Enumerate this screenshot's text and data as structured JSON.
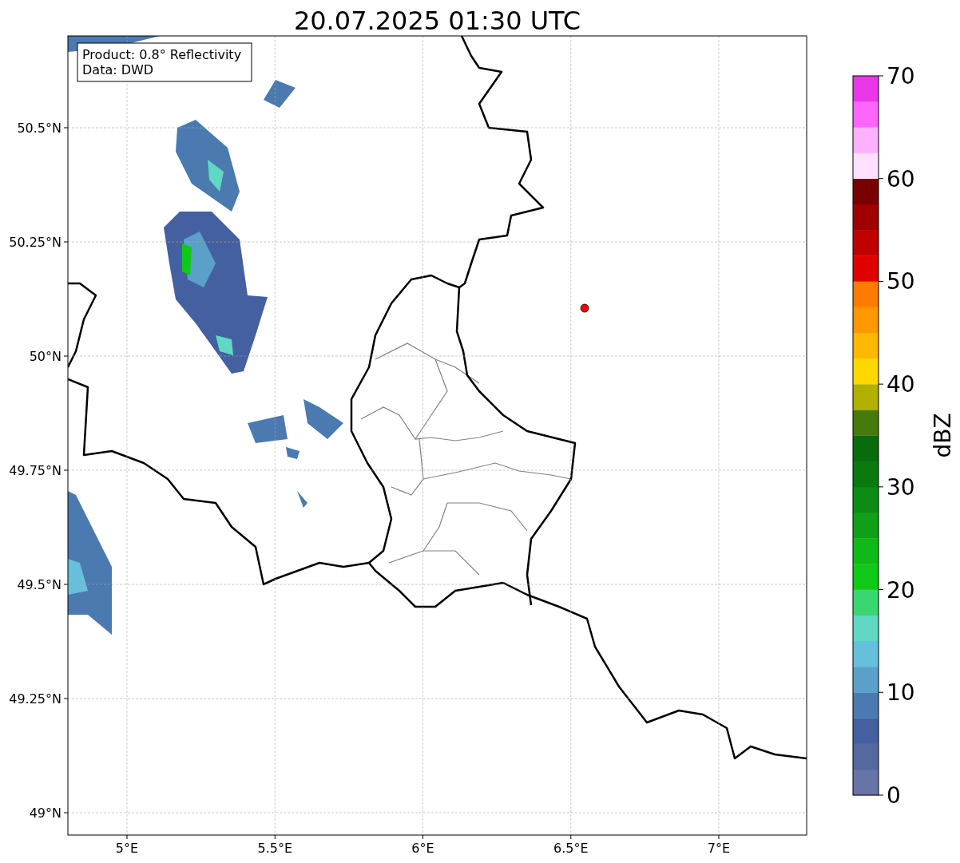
{
  "title": "20.07.2025 01:30 UTC",
  "legend": [
    "Product: 0.8° Reflectivity",
    "Data: DWD"
  ],
  "y_ticks": [
    "50.5°N",
    "50.25°N",
    "50°N",
    "49.75°N",
    "49.5°N",
    "49.25°N",
    "49°N"
  ],
  "x_ticks": [
    "5°E",
    "5.5°E",
    "6°E",
    "6.5°E",
    "7°E"
  ],
  "colorbar": {
    "label": "dBZ",
    "ticks": [
      "70",
      "60",
      "50",
      "40",
      "30",
      "20",
      "10",
      "0"
    ],
    "bands": [
      {
        "color": "#6674a8"
      },
      {
        "color": "#5668a0"
      },
      {
        "color": "#4560a0"
      },
      {
        "color": "#4a7ab0"
      },
      {
        "color": "#5aa0c8"
      },
      {
        "color": "#66c0dc"
      },
      {
        "color": "#60d8c4"
      },
      {
        "color": "#3cd670"
      },
      {
        "color": "#10c818"
      },
      {
        "color": "#10b818"
      },
      {
        "color": "#10a018"
      },
      {
        "color": "#0c8c14"
      },
      {
        "color": "#0a7a10"
      },
      {
        "color": "#086c0c"
      },
      {
        "color": "#467a0a"
      },
      {
        "color": "#b0b000"
      },
      {
        "color": "#ffd800"
      },
      {
        "color": "#ffb800"
      },
      {
        "color": "#ff9800"
      },
      {
        "color": "#ff7c00"
      },
      {
        "color": "#e00000"
      },
      {
        "color": "#c00000"
      },
      {
        "color": "#a00000"
      },
      {
        "color": "#780000"
      },
      {
        "color": "#ffe0ff"
      },
      {
        "color": "#ffb0ff"
      },
      {
        "color": "#ff66ff"
      },
      {
        "color": "#e838e8"
      }
    ]
  }
}
